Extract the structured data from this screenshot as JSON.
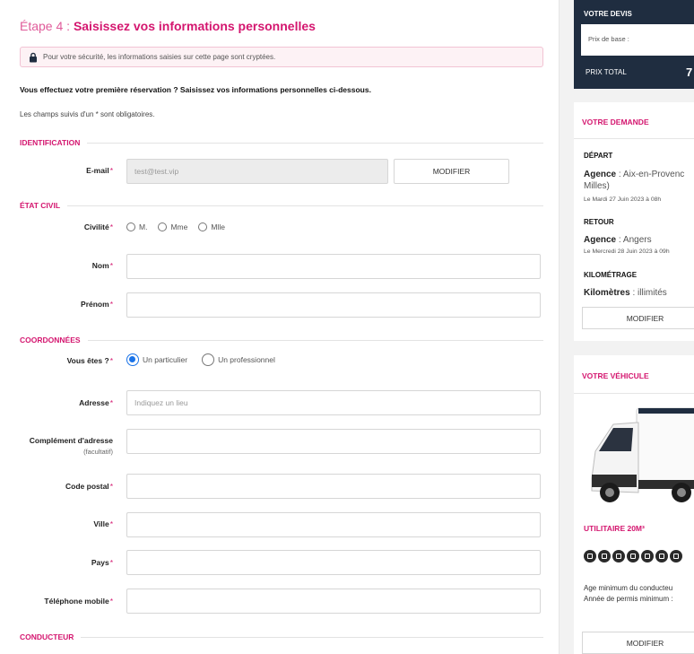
{
  "step": {
    "number": "Étape 4 :",
    "title": "Saisissez vos informations personnelles"
  },
  "security_notice": "Pour votre sécurité, les informations saisies sur cette page sont cryptées.",
  "intro": "Vous effectuez votre première réservation ? Saisissez vos informations personnelles ci-dessous.",
  "mandatory_note": "Les champs suivis d'un * sont obligatoires.",
  "required_mark": "*",
  "sections": {
    "identification": "IDENTIFICATION",
    "etat_civil": "ÉTAT CIVIL",
    "coordonnees": "COORDONNÉES",
    "conducteur": "CONDUCTEUR"
  },
  "identification": {
    "email_label": "E-mail",
    "email_value": "test@test.vip",
    "modify_label": "MODIFIER"
  },
  "etat_civil": {
    "civilite_label": "Civilité",
    "civilite_options": [
      "M.",
      "Mme",
      "Mlle"
    ],
    "nom_label": "Nom",
    "prenom_label": "Prénom"
  },
  "coordonnees": {
    "vous_etes_label": "Vous êtes ?",
    "type_options": [
      "Un particulier",
      "Un professionnel"
    ],
    "type_selected": "Un particulier",
    "adresse_label": "Adresse",
    "adresse_placeholder": "Indiquez un lieu",
    "complement_label": "Complément d'adresse",
    "complement_sub": "(facultatif)",
    "code_postal_label": "Code postal",
    "ville_label": "Ville",
    "pays_label": "Pays",
    "telephone_label": "Téléphone mobile"
  },
  "sidebar": {
    "devis": {
      "title": "VOTRE DEVIS",
      "base_label": "Prix de base :",
      "total_label": "PRIX TOTAL",
      "total_value": "7"
    },
    "demande": {
      "title": "VOTRE DEMANDE",
      "depart_head": "DÉPART",
      "depart_type": "Agence",
      "depart_place": "Aix-en-Provenc",
      "depart_place2": "Milles)",
      "depart_date": "Le Mardi 27 Juin 2023 à 08h",
      "retour_head": "RETOUR",
      "retour_type": "Agence",
      "retour_place": "Angers",
      "retour_date": "Le Mercredi 28 Juin 2023 à 09h",
      "km_head": "KILOMÉTRAGE",
      "km_label": "Kilomètres",
      "km_value": "illimités",
      "modify_label": "MODIFIER"
    },
    "vehicule": {
      "title": "VOTRE VÉHICULE",
      "name": "UTILITAIRE 20M³",
      "features": [
        "cube-icon",
        "seat-icon",
        "person-icon",
        "fuel-icon",
        "snowflake-icon",
        "gps-icon",
        "more-icon"
      ],
      "age_line": "Age minimum du conducteu",
      "permis_line": "Année de permis minimum :",
      "modify_label": "MODIFIER"
    }
  },
  "colors": {
    "accent": "#d4166f",
    "dark": "#1f2d40",
    "radio_selected": "#1a73e8"
  }
}
